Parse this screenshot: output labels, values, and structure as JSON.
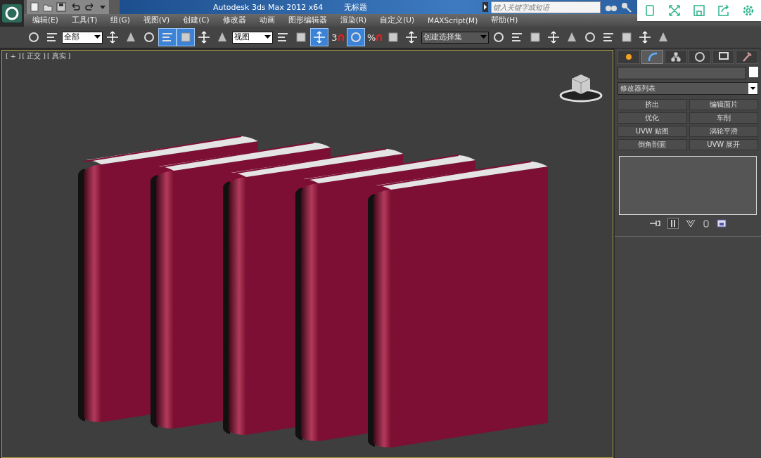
{
  "title_bar": {
    "app_title": "Autodesk 3ds Max  2012 x64",
    "document_title": "无标题",
    "search": {
      "placeholder": "键入关键字或短语"
    }
  },
  "menu": [
    "编辑(E)",
    "工具(T)",
    "组(G)",
    "视图(V)",
    "创建(C)",
    "修改器",
    "动画",
    "图形编辑器",
    "渲染(R)",
    "自定义(U)",
    "MAXScript(M)",
    "帮助(H)"
  ],
  "toolbar": [
    {
      "kind": "icon",
      "on": false
    },
    {
      "kind": "icon",
      "on": false
    },
    {
      "kind": "dropdown",
      "value": "全部"
    },
    {
      "kind": "icon",
      "on": false
    },
    {
      "kind": "icon",
      "on": false
    },
    {
      "kind": "icon",
      "on": false
    },
    {
      "kind": "icon",
      "on": true
    },
    {
      "kind": "icon",
      "on": true
    },
    {
      "kind": "icon",
      "on": false
    },
    {
      "kind": "icon",
      "on": false
    },
    {
      "kind": "dropdown",
      "value": "视图"
    },
    {
      "kind": "icon",
      "on": false
    },
    {
      "kind": "icon",
      "on": false
    },
    {
      "kind": "icon",
      "on": true
    },
    {
      "kind": "snap",
      "label": "3",
      "on": false
    },
    {
      "kind": "icon",
      "on": true
    },
    {
      "kind": "snap",
      "label": "%",
      "on": false
    },
    {
      "kind": "icon",
      "on": false
    },
    {
      "kind": "icon",
      "on": false
    },
    {
      "kind": "dropdown",
      "value": "创建选择集"
    },
    {
      "kind": "icon",
      "on": false
    },
    {
      "kind": "icon",
      "on": false
    },
    {
      "kind": "icon",
      "on": false
    },
    {
      "kind": "icon",
      "on": false
    },
    {
      "kind": "icon",
      "on": false
    },
    {
      "kind": "icon",
      "on": false
    },
    {
      "kind": "icon",
      "on": false
    },
    {
      "kind": "icon",
      "on": false
    },
    {
      "kind": "icon",
      "on": false
    },
    {
      "kind": "icon",
      "on": false
    }
  ],
  "viewport": {
    "labels": [
      "[ + ]",
      "[ 正交 ]",
      "[ 真实 ]"
    ]
  },
  "command_panel": {
    "tabs": [
      {
        "selected": false
      },
      {
        "selected": true
      },
      {
        "selected": false
      },
      {
        "selected": false
      },
      {
        "selected": false
      },
      {
        "selected": false
      }
    ],
    "modifier_list": "修改器列表",
    "modifier_buttons": [
      "挤出",
      "编辑面片",
      "优化",
      "车削",
      "UVW 贴图",
      "涡轮平滑",
      "倒角剖面",
      "UVW 展开"
    ]
  }
}
